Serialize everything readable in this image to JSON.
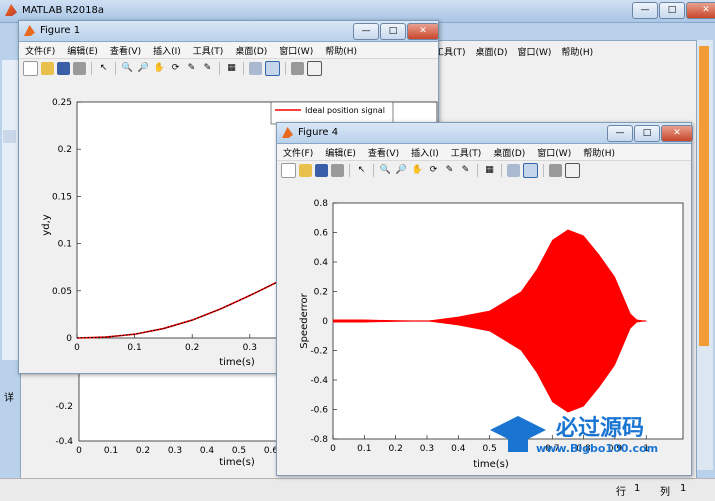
{
  "main_window": {
    "title": "MATLAB R2018a",
    "status_row": "行",
    "status_row_val": "1",
    "status_col": "列",
    "status_col_val": "1",
    "side_label": "详"
  },
  "menus": [
    "文件(F)",
    "编辑(E)",
    "查看(V)",
    "插入(I)",
    "工具(T)",
    "桌面(D)",
    "窗口(W)",
    "帮助(H)"
  ],
  "figure1": {
    "title": "Figure 1",
    "legend": "Ideal position signal"
  },
  "figure4": {
    "title": "Figure 4"
  },
  "watermark": {
    "cn": "必过源码",
    "url": "www.Bigbo100.com"
  },
  "colors": {
    "signal": "#ff0000",
    "tracking": "#000000"
  },
  "chart_data": [
    {
      "type": "line",
      "ylabel": "yd,y",
      "xlabel": "time(s)",
      "xlim": [
        0,
        1
      ],
      "ylim": [
        0,
        0.25
      ],
      "xticks": [
        "0",
        "0.1",
        "0.2",
        "0.3",
        "0.4",
        "0.5",
        "0.6"
      ],
      "yticks": [
        "0",
        "0.05",
        "0.1",
        "0.15",
        "0.2",
        "0.25"
      ],
      "series": [
        {
          "name": "Ideal position signal",
          "x": [
            0,
            0.05,
            0.1,
            0.15,
            0.2,
            0.25,
            0.3,
            0.35,
            0.4,
            0.45,
            0.5,
            0.55,
            0.6,
            0.62
          ],
          "y": [
            0,
            0.001,
            0.004,
            0.01,
            0.019,
            0.031,
            0.045,
            0.06,
            0.075,
            0.09,
            0.105,
            0.12,
            0.135,
            0.141
          ]
        }
      ]
    },
    {
      "type": "line",
      "ylabel": "Speederror",
      "xlabel": "time(s)",
      "xlim": [
        0,
        1
      ],
      "ylim": [
        -0.8,
        0.8
      ],
      "xticks": [
        "0",
        "0.1",
        "0.2",
        "0.3",
        "0.4",
        "0.5",
        "0.7",
        "0.8",
        "0.9",
        "1"
      ],
      "yticks": [
        "-0.8",
        "-0.6",
        "-0.4",
        "-0.2",
        "0",
        "0.2",
        "0.4",
        "0.6",
        "0.8"
      ],
      "series": [
        {
          "name": "",
          "x": [
            0,
            0.1,
            0.2,
            0.3,
            0.4,
            0.5,
            0.6,
            0.65,
            0.7,
            0.75,
            0.8,
            0.85,
            0.9,
            0.93,
            0.95,
            0.97,
            1
          ],
          "y_envelope": [
            0.01,
            0.01,
            0.005,
            0.002,
            0.03,
            0.07,
            0.2,
            0.35,
            0.55,
            0.62,
            0.58,
            0.45,
            0.3,
            0.15,
            0.05,
            0.01,
            0.0
          ]
        }
      ]
    },
    {
      "type": "line",
      "xlabel": "time(s)",
      "xlim": [
        0,
        1
      ],
      "ylim": [
        -0.4,
        0
      ],
      "xticks": [
        "0",
        "0.1",
        "0.2",
        "0.3",
        "0.4",
        "0.5",
        "0.6"
      ],
      "yticks": [
        "-0.2",
        "-0.4"
      ],
      "series": []
    }
  ]
}
